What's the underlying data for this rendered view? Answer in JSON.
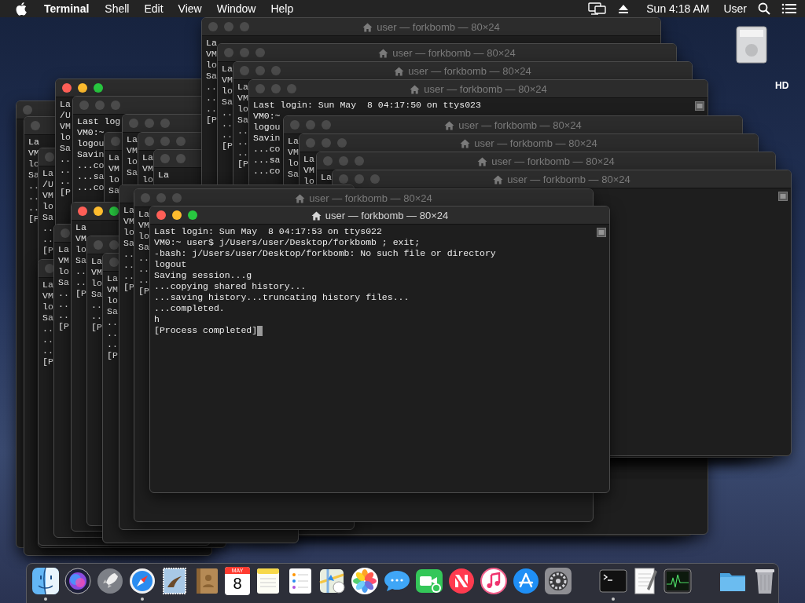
{
  "menu_bar": {
    "app_name": "Terminal",
    "menus": [
      "Shell",
      "Edit",
      "View",
      "Window",
      "Help"
    ],
    "clock": "Sun 4:18 AM",
    "user": "User"
  },
  "desktop_icons": [
    {
      "label": "HD"
    }
  ],
  "windows": [
    {
      "active": false
    },
    {
      "active": false,
      "lines": [
        "La",
        "VM",
        "lo",
        "Sa",
        "..",
        "..",
        "..",
        "[P"
      ]
    },
    {
      "active": false,
      "lines": [
        "La",
        "/U",
        "VM",
        "lo",
        "Sa",
        "..",
        "..",
        "[P"
      ]
    },
    {
      "active": true,
      "lines": [
        "La",
        "/U",
        "VM",
        "lo",
        "Sa",
        "..",
        "..",
        "..",
        "[P"
      ]
    },
    {
      "active": false,
      "lines": [
        "Last log",
        "VM0:~",
        "logou",
        "Savin",
        "...co",
        "...sa",
        "...co"
      ]
    },
    {
      "active": false,
      "lines": [
        "La",
        "VM",
        "lo",
        "Sa"
      ]
    },
    {
      "active": false,
      "lines": [
        "La",
        "VM",
        "lo",
        "Sa"
      ]
    },
    {
      "active": false,
      "lines": [
        "La",
        "VM",
        "lo"
      ]
    },
    {
      "active": false,
      "lines": [
        "La"
      ]
    },
    {
      "title": "user — forkbomb — 80×24",
      "active": false,
      "lines": [
        "La",
        "VM",
        "lo",
        "Sa",
        "..",
        "..",
        "..",
        "[P"
      ]
    },
    {
      "title": "user — forkbomb — 80×24",
      "active": false,
      "lines": [
        "La",
        "VM",
        "lo",
        "Sa",
        "..",
        "..",
        "..",
        "[P"
      ]
    },
    {
      "title": "user — forkbomb — 80×24",
      "active": false,
      "lines": [
        "La",
        "VM",
        "lo",
        "Sa",
        "..",
        "..",
        "..",
        "[P"
      ]
    },
    {
      "title": "user — forkbomb — 80×24",
      "active": false,
      "scroll_indicator": true,
      "lines": [
        "Last login: Sun May  8 04:17:50 on ttys023",
        "VM0:~",
        "logou",
        "Savin",
        "...co",
        "...sa",
        "...co"
      ]
    },
    {
      "title": "user — forkbomb — 80×24",
      "active": false,
      "lines": [
        "La",
        "VM",
        "lo",
        "Sa"
      ]
    },
    {
      "title": "user — forkbomb — 80×24",
      "active": false,
      "lines": [
        "La",
        "VM",
        "lo"
      ]
    },
    {
      "title": "user — forkbomb — 80×24",
      "active": false,
      "lines": [
        "La"
      ]
    },
    {
      "title": "user — forkbomb — 80×24",
      "active": false,
      "scroll_indicator": true
    },
    {
      "active": false,
      "lines": [
        "La",
        "VM",
        "lo",
        "Sa",
        "..",
        "..",
        "..",
        "[P"
      ]
    },
    {
      "active": false,
      "lines": [
        "La",
        "VM",
        "lo",
        "Sa",
        "..",
        "..",
        "..",
        "[P"
      ]
    },
    {
      "active": true,
      "lines": [
        "La",
        "VM",
        "lo",
        "Sa",
        "..",
        "..",
        "[P"
      ]
    },
    {
      "active": false,
      "lines": [
        "La",
        "VM",
        "lo",
        "Sa",
        "..",
        "..",
        "[P"
      ]
    },
    {
      "active": false,
      "lines": [
        "La",
        "VM",
        "lo",
        "Sa",
        "..",
        "..",
        "..",
        "[P"
      ]
    },
    {
      "lines": [
        "La",
        "VM",
        "lo",
        "Sa",
        "..",
        "..",
        "..",
        "[P"
      ]
    },
    {
      "title": "user — forkbomb — 80×24",
      "active": false,
      "lines": [
        "La",
        "VM",
        "lo",
        "Sa",
        "..",
        "..",
        "..",
        "[P"
      ]
    },
    {
      "title": "user — forkbomb — 80×24",
      "active": true,
      "scroll_indicator": true,
      "cursor_visible": true,
      "lines": [
        "Last login: Sun May  8 04:17:53 on ttys022",
        "VM0:~ user$ j/Users/user/Desktop/forkbomb ; exit;",
        "-bash: j/Users/user/Desktop/forkbomb: No such file or directory",
        "logout",
        "Saving session...g",
        "...copying shared history...",
        "...saving history...truncating history files...",
        "...completed.",
        "h",
        "[Process completed]"
      ]
    }
  ],
  "dock": {
    "items": [
      {
        "kind": "finder",
        "running": true
      },
      {
        "kind": "siri",
        "running": false
      },
      {
        "kind": "launchpad",
        "running": false
      },
      {
        "kind": "safari",
        "running": true
      },
      {
        "kind": "mail",
        "running": false
      },
      {
        "kind": "contacts",
        "running": false
      },
      {
        "kind": "calendar",
        "running": false,
        "month": "MAY",
        "day": "8"
      },
      {
        "kind": "notes",
        "running": false
      },
      {
        "kind": "reminders",
        "running": false
      },
      {
        "kind": "maps",
        "running": false
      },
      {
        "kind": "photos",
        "running": false
      },
      {
        "kind": "messages",
        "running": false
      },
      {
        "kind": "facetime",
        "running": false
      },
      {
        "kind": "news",
        "running": false
      },
      {
        "kind": "music",
        "running": false
      },
      {
        "kind": "appstore",
        "running": false
      },
      {
        "kind": "settings",
        "running": false
      },
      {
        "kind": "separator"
      },
      {
        "kind": "terminal",
        "running": true
      },
      {
        "kind": "textedit",
        "running": false
      },
      {
        "kind": "activity",
        "running": false
      },
      {
        "kind": "separator"
      },
      {
        "kind": "folder",
        "running": false
      },
      {
        "kind": "trash",
        "running": false
      }
    ]
  }
}
